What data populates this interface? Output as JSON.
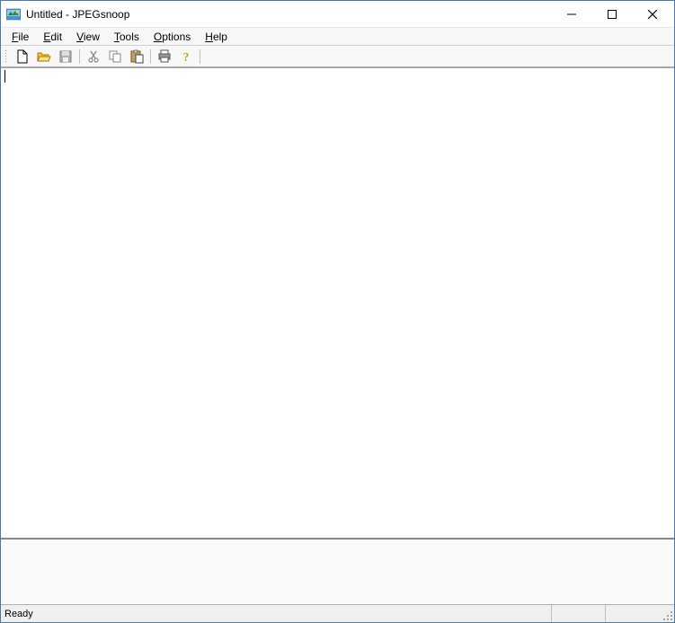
{
  "titlebar": {
    "title": "Untitled - JPEGsnoop"
  },
  "menu": {
    "file": "File",
    "edit": "Edit",
    "view": "View",
    "tools": "Tools",
    "options": "Options",
    "help": "Help"
  },
  "toolbar": {
    "new": "New",
    "open": "Open",
    "save": "Save",
    "cut": "Cut",
    "copy": "Copy",
    "paste": "Paste",
    "print": "Print",
    "help": "Help"
  },
  "statusbar": {
    "status": "Ready"
  }
}
